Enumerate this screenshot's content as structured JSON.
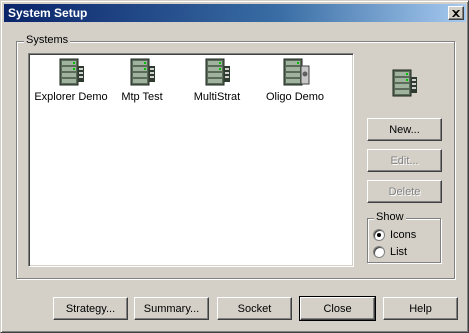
{
  "window": {
    "title": "System Setup"
  },
  "systems_group": {
    "label": "Systems",
    "items": [
      {
        "label": "Explorer Demo",
        "icon": "server-icon"
      },
      {
        "label": "Mtp Test",
        "icon": "server-icon"
      },
      {
        "label": "MultiStrat",
        "icon": "server-icon"
      },
      {
        "label": "Oligo Demo",
        "icon": "server-disk-icon"
      }
    ]
  },
  "side_buttons": {
    "new": "New...",
    "edit": "Edit...",
    "delete": "Delete"
  },
  "show_group": {
    "label": "Show",
    "options": [
      {
        "label": "Icons",
        "selected": true
      },
      {
        "label": "List",
        "selected": false
      }
    ]
  },
  "bottom_buttons": {
    "strategy": "Strategy...",
    "summary": "Summary...",
    "socket": "Socket",
    "close": "Close",
    "help": "Help"
  },
  "colors": {
    "titlebar_start": "#0a246a",
    "titlebar_end": "#a6caf0",
    "face": "#d4d0c8"
  }
}
